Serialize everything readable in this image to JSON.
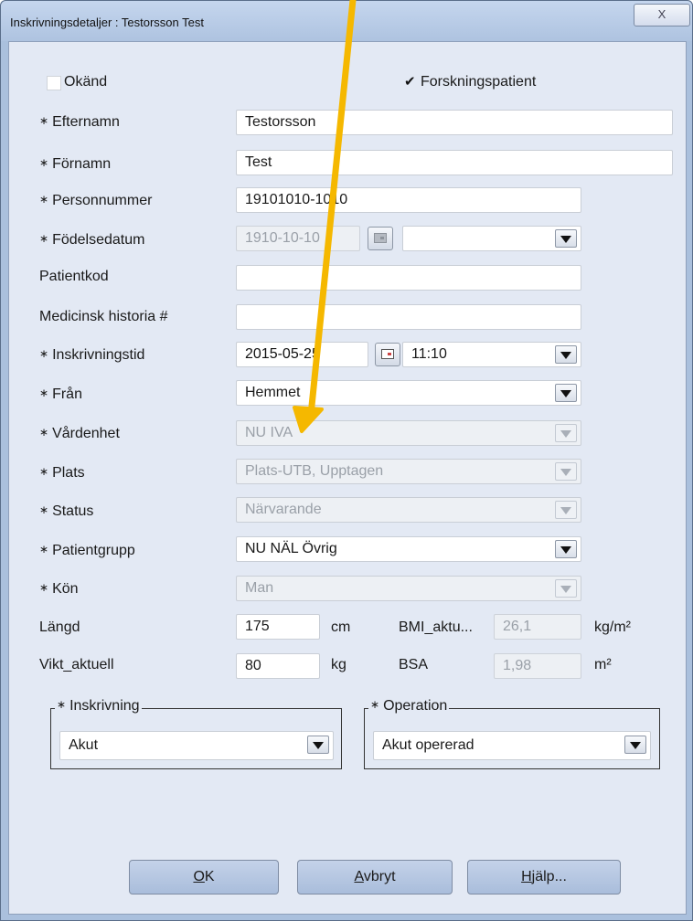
{
  "window": {
    "title": "Inskrivningsdetaljer : Testorsson Test",
    "close_label": "X"
  },
  "top": {
    "unknown_label": "Okänd",
    "unknown_checked": false,
    "research_label": "Forskningspatient",
    "research_checked": true
  },
  "required_marker": "∗",
  "fields": {
    "efternamn": {
      "label": "Efternamn",
      "value": "Testorsson"
    },
    "fornamn": {
      "label": "Förnamn",
      "value": "Test"
    },
    "personnummer": {
      "label": "Personnummer",
      "value": "19101010-1010"
    },
    "fodelsedatum": {
      "label": "Födelsedatum",
      "value": "1910-10-10",
      "extra": ""
    },
    "patientkod": {
      "label": "Patientkod",
      "value": ""
    },
    "medhist": {
      "label": "Medicinsk historia #",
      "value": ""
    },
    "inskrivningstid": {
      "label": "Inskrivningstid",
      "date": "2015-05-25",
      "time": "11:10"
    },
    "fran": {
      "label": "Från",
      "value": "Hemmet"
    },
    "vardenhet": {
      "label": "Vårdenhet",
      "value": "NU IVA"
    },
    "plats": {
      "label": "Plats",
      "value": "Plats-UTB, Upptagen"
    },
    "status": {
      "label": "Status",
      "value": "Närvarande"
    },
    "patientgrupp": {
      "label": "Patientgrupp",
      "value": "NU NÄL Övrig"
    },
    "kon": {
      "label": "Kön",
      "value": "Man"
    },
    "langd": {
      "label": "Längd",
      "value": "175",
      "unit": "cm"
    },
    "bmi": {
      "label": "BMI_aktu...",
      "value": "26,1",
      "unit": "kg/m²"
    },
    "vikt": {
      "label": "Vikt_aktuell",
      "value": "80",
      "unit": "kg"
    },
    "bsa": {
      "label": "BSA",
      "value": "1,98",
      "unit": "m²"
    }
  },
  "inskrivning": {
    "label": "Inskrivning",
    "value": "Akut"
  },
  "operation": {
    "label": "Operation",
    "value": "Akut opererad"
  },
  "buttons": {
    "ok": "OK",
    "ok_mn": "O",
    "ok_rest": "K",
    "avbryt_mn": "A",
    "avbryt_rest": "vbryt",
    "hjalp_mn": "H",
    "hjalp_rest": "jälp..."
  },
  "colors": {
    "annotation_arrow": "#f5b800"
  }
}
